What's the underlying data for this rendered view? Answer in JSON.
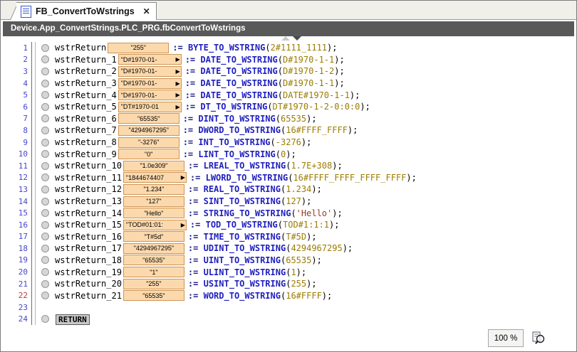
{
  "tab": {
    "title": "FB_ConvertToWstrings",
    "close_glyph": "✕"
  },
  "breadcrumb": "Device.App_ConvertStrings.PLC_PRG.fbConvertToWstrings",
  "statusbar": {
    "zoom_level": "100 %"
  },
  "icons": {
    "tab_document": "pou-document-icon",
    "tab_close": "close-icon",
    "monitor_expand": "▶",
    "splitter_up": "collapse-up-icon",
    "splitter_down": "collapse-down-icon",
    "zoom": "magnifier-icon"
  },
  "colors": {
    "titlebar_bg": "#595959",
    "monitor_box_bg": "#fbd9ac",
    "monitor_box_border": "#ce9455",
    "keyword_blue": "#2020c0",
    "number_olive": "#9c7c00",
    "string_maroon": "#993825",
    "line_number_blue": "#4646c8",
    "line_number_red": "#c23a2e"
  },
  "editor": {
    "lines": [
      {
        "n": "1",
        "name": "wstrReturn",
        "value": "\"255\"",
        "arrow": false,
        "seg": [
          [
            ":= ",
            "op"
          ],
          [
            "BYTE_TO_WSTRING",
            "fn"
          ],
          [
            "(",
            "pl"
          ],
          [
            "2#1111_1111",
            "num"
          ],
          [
            ");",
            "pl"
          ]
        ]
      },
      {
        "n": "2",
        "name": "wstrReturn_1",
        "value": "\"D#1970-01-",
        "arrow": true,
        "seg": [
          [
            ":= ",
            "op"
          ],
          [
            "DATE_TO_WSTRING",
            "fn"
          ],
          [
            "(",
            "pl"
          ],
          [
            "D#1970-1-1",
            "num"
          ],
          [
            ");",
            "pl"
          ]
        ]
      },
      {
        "n": "3",
        "name": "wstrReturn_2",
        "value": "\"D#1970-01-",
        "arrow": true,
        "seg": [
          [
            ":= ",
            "op"
          ],
          [
            "DATE_TO_WSTRING",
            "fn"
          ],
          [
            "(",
            "pl"
          ],
          [
            "D#1970-1-2",
            "num"
          ],
          [
            ");",
            "pl"
          ]
        ]
      },
      {
        "n": "4",
        "name": "wstrReturn_3",
        "value": "\"D#1970-01-",
        "arrow": true,
        "seg": [
          [
            ":= ",
            "op"
          ],
          [
            "DATE_TO_WSTRING",
            "fn"
          ],
          [
            "(",
            "pl"
          ],
          [
            "D#1970-1-1",
            "num"
          ],
          [
            ");",
            "pl"
          ]
        ]
      },
      {
        "n": "5",
        "name": "wstrReturn_4",
        "value": "\"D#1970-01-",
        "arrow": true,
        "seg": [
          [
            ":= ",
            "op"
          ],
          [
            "DATE_TO_WSTRING",
            "fn"
          ],
          [
            "(",
            "pl"
          ],
          [
            "DATE#1970-1-1",
            "num"
          ],
          [
            ");",
            "pl"
          ]
        ]
      },
      {
        "n": "6",
        "name": "wstrReturn_5",
        "value": "\"DT#1970-01",
        "arrow": true,
        "seg": [
          [
            ":= ",
            "op"
          ],
          [
            "DT_TO_WSTRING",
            "fn"
          ],
          [
            "(",
            "pl"
          ],
          [
            "DT#1970-1-2-0:0:0",
            "num"
          ],
          [
            ");",
            "pl"
          ]
        ]
      },
      {
        "n": "7",
        "name": "wstrReturn_6",
        "value": "\"65535\"",
        "arrow": false,
        "seg": [
          [
            ":= ",
            "op"
          ],
          [
            "DINT_TO_WSTRING",
            "fn"
          ],
          [
            "(",
            "pl"
          ],
          [
            "65535",
            "num"
          ],
          [
            ");",
            "pl"
          ]
        ]
      },
      {
        "n": "8",
        "name": "wstrReturn_7",
        "value": "\"4294967295\"",
        "arrow": false,
        "seg": [
          [
            ":= ",
            "op"
          ],
          [
            "DWORD_TO_WSTRING",
            "fn"
          ],
          [
            "(",
            "pl"
          ],
          [
            "16#FFFF_FFFF",
            "num"
          ],
          [
            ");",
            "pl"
          ]
        ]
      },
      {
        "n": "9",
        "name": "wstrReturn_8",
        "value": "\"-3276\"",
        "arrow": false,
        "seg": [
          [
            ":= ",
            "op"
          ],
          [
            "INT_TO_WSTRING",
            "fn"
          ],
          [
            "(",
            "pl"
          ],
          [
            "-3276",
            "num"
          ],
          [
            ");",
            "pl"
          ]
        ]
      },
      {
        "n": "10",
        "name": "wstrReturn_9",
        "value": "\"0\"",
        "arrow": false,
        "seg": [
          [
            ":= ",
            "op"
          ],
          [
            "LINT_TO_WSTRING",
            "fn"
          ],
          [
            "(",
            "pl"
          ],
          [
            "0",
            "num"
          ],
          [
            ");",
            "pl"
          ]
        ]
      },
      {
        "n": "11",
        "name": "wstrReturn_10",
        "value": "\"1.0e309\"",
        "arrow": false,
        "seg": [
          [
            ":= ",
            "op"
          ],
          [
            "LREAL_TO_WSTRING",
            "fn"
          ],
          [
            "(",
            "pl"
          ],
          [
            "1.7E+308",
            "num"
          ],
          [
            ");",
            "pl"
          ]
        ]
      },
      {
        "n": "12",
        "name": "wstrReturn_11",
        "value": "\"1844674407",
        "arrow": true,
        "seg": [
          [
            ":= ",
            "op"
          ],
          [
            "LWORD_TO_WSTRING",
            "fn"
          ],
          [
            "(",
            "pl"
          ],
          [
            "16#FFFF_FFFF_FFFF_FFFF",
            "num"
          ],
          [
            ");",
            "pl"
          ]
        ]
      },
      {
        "n": "13",
        "name": "wstrReturn_12",
        "value": "\"1.234\"",
        "arrow": false,
        "seg": [
          [
            ":= ",
            "op"
          ],
          [
            "REAL_TO_WSTRING",
            "fn"
          ],
          [
            "(",
            "pl"
          ],
          [
            "1.234",
            "num"
          ],
          [
            ");",
            "pl"
          ]
        ]
      },
      {
        "n": "14",
        "name": "wstrReturn_13",
        "value": "\"127\"",
        "arrow": false,
        "seg": [
          [
            ":= ",
            "op"
          ],
          [
            "SINT_TO_WSTRING",
            "fn"
          ],
          [
            "(",
            "pl"
          ],
          [
            "127",
            "num"
          ],
          [
            ");",
            "pl"
          ]
        ]
      },
      {
        "n": "15",
        "name": "wstrReturn_14",
        "value": "\"Hello\"",
        "arrow": false,
        "seg": [
          [
            ":= ",
            "op"
          ],
          [
            "STRING_TO_WSTRING",
            "fn"
          ],
          [
            "(",
            "pl"
          ],
          [
            "'Hello'",
            "str"
          ],
          [
            ");",
            "pl"
          ]
        ]
      },
      {
        "n": "16",
        "name": "wstrReturn_15",
        "value": "\"TOD#01:01:",
        "arrow": true,
        "seg": [
          [
            ":= ",
            "op"
          ],
          [
            "TOD_TO_WSTRING",
            "fn"
          ],
          [
            "(",
            "pl"
          ],
          [
            "TOD#1:1:1",
            "num"
          ],
          [
            ");",
            "pl"
          ]
        ]
      },
      {
        "n": "17",
        "name": "wstrReturn_16",
        "value": "\"T#5d\"",
        "arrow": false,
        "seg": [
          [
            ":= ",
            "op"
          ],
          [
            "TIME_TO_WSTRING",
            "fn"
          ],
          [
            "(",
            "pl"
          ],
          [
            "T#5D",
            "num"
          ],
          [
            ");",
            "pl"
          ]
        ]
      },
      {
        "n": "18",
        "name": "wstrReturn_17",
        "value": "\"4294967295\"",
        "arrow": false,
        "seg": [
          [
            ":= ",
            "op"
          ],
          [
            "UDINT_TO_WSTRING",
            "fn"
          ],
          [
            "(",
            "pl"
          ],
          [
            "4294967295",
            "num"
          ],
          [
            ");",
            "pl"
          ]
        ]
      },
      {
        "n": "19",
        "name": "wstrReturn_18",
        "value": "\"65535\"",
        "arrow": false,
        "seg": [
          [
            ":= ",
            "op"
          ],
          [
            "UINT_TO_WSTRING",
            "fn"
          ],
          [
            "(",
            "pl"
          ],
          [
            "65535",
            "num"
          ],
          [
            ");",
            "pl"
          ]
        ]
      },
      {
        "n": "20",
        "name": "wstrReturn_19",
        "value": "\"1\"",
        "arrow": false,
        "seg": [
          [
            ":= ",
            "op"
          ],
          [
            "ULINT_TO_WSTRING",
            "fn"
          ],
          [
            "(",
            "pl"
          ],
          [
            "1",
            "num"
          ],
          [
            ");",
            "pl"
          ]
        ]
      },
      {
        "n": "21",
        "name": "wstrReturn_20",
        "value": "\"255\"",
        "arrow": false,
        "seg": [
          [
            ":= ",
            "op"
          ],
          [
            "USINT_TO_WSTRING",
            "fn"
          ],
          [
            "(",
            "pl"
          ],
          [
            "255",
            "num"
          ],
          [
            ");",
            "pl"
          ]
        ]
      },
      {
        "n": "22",
        "red": true,
        "name": "wstrReturn_21",
        "value": "\"65535\"",
        "arrow": false,
        "seg": [
          [
            ":= ",
            "op"
          ],
          [
            "WORD_TO_WSTRING",
            "fn"
          ],
          [
            "(",
            "pl"
          ],
          [
            "16#FFFF",
            "num"
          ],
          [
            ");",
            "pl"
          ]
        ]
      },
      {
        "n": "23"
      },
      {
        "n": "24",
        "return": "RETURN"
      }
    ]
  }
}
